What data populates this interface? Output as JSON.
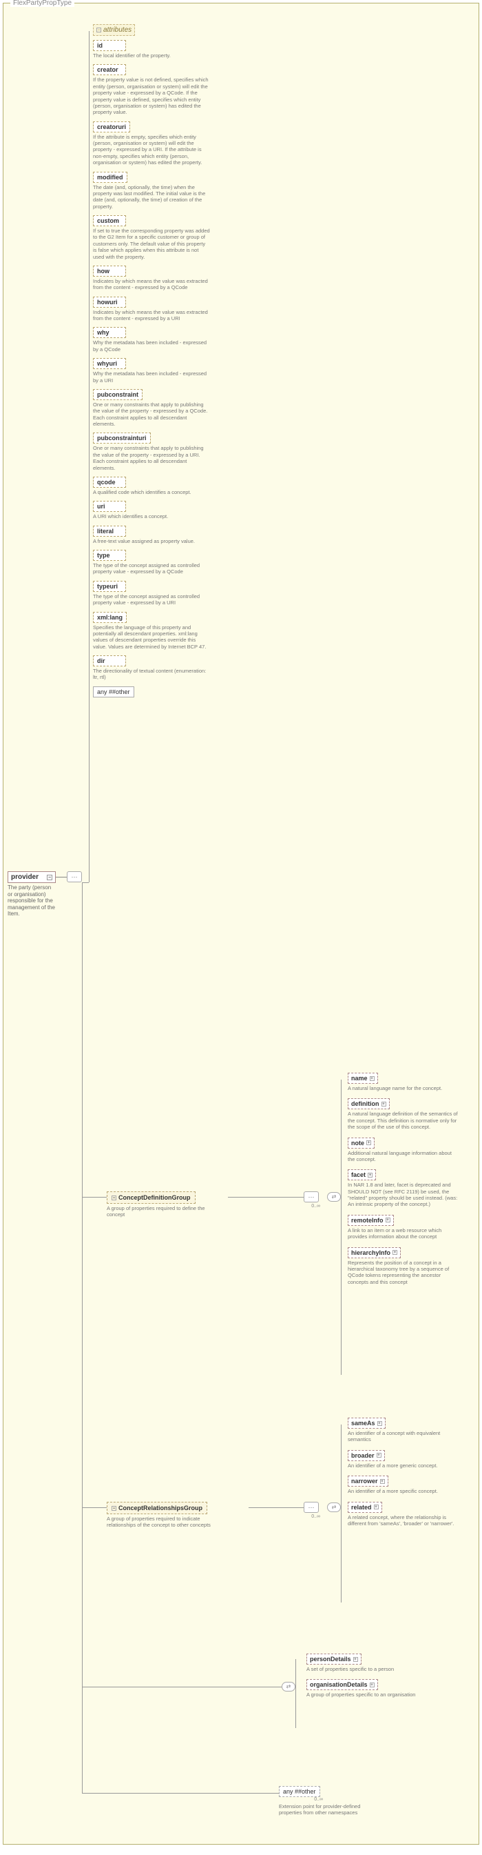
{
  "outerTitle": "FlexPartyPropType",
  "provider": {
    "label": "provider",
    "desc": "The party (person or organisation) responsible for the management of the Item."
  },
  "attributesLabel": "attributes",
  "attributes": [
    {
      "name": "id",
      "desc": "The local identifier of the property."
    },
    {
      "name": "creator",
      "desc": "If the property value is not defined, specifies which entity (person, organisation or system) will edit the property value - expressed by a QCode. If the property value is defined, specifies which entity (person, organisation or system) has edited the property value."
    },
    {
      "name": "creatoruri",
      "desc": "If the attribute is empty, specifies which entity (person, organisation or system) will edit the property - expressed by a URI. If the attribute is non-empty, specifies which entity (person, organisation or system) has edited the property."
    },
    {
      "name": "modified",
      "desc": "The date (and, optionally, the time) when the property was last modified. The initial value is the date (and, optionally, the time) of creation of the property."
    },
    {
      "name": "custom",
      "desc": "If set to true the corresponding property was added to the G2 Item for a specific customer or group of customers only. The default value of this property is false which applies when this attribute is not used with the property."
    },
    {
      "name": "how",
      "desc": "Indicates by which means the value was extracted from the content - expressed by a QCode"
    },
    {
      "name": "howuri",
      "desc": "Indicates by which means the value was extracted from the content - expressed by a URI"
    },
    {
      "name": "why",
      "desc": "Why the metadata has been included - expressed by a QCode"
    },
    {
      "name": "whyuri",
      "desc": "Why the metadata has been included - expressed by a URI"
    },
    {
      "name": "pubconstraint",
      "desc": "One or many constraints that apply to publishing the value of the property - expressed by a QCode. Each constraint applies to all descendant elements."
    },
    {
      "name": "pubconstrainturi",
      "desc": "One or many constraints that apply to publishing the value of the property - expressed by a URI. Each constraint applies to all descendant elements."
    },
    {
      "name": "qcode",
      "desc": "A qualified code which identifies a concept."
    },
    {
      "name": "uri",
      "desc": "A URI which identifies a concept."
    },
    {
      "name": "literal",
      "desc": "A free-text value assigned as property value."
    },
    {
      "name": "type",
      "desc": "The type of the concept assigned as controlled property value - expressed by a QCode"
    },
    {
      "name": "typeuri",
      "desc": "The type of the concept assigned as controlled property value - expressed by a URI"
    },
    {
      "name": "xml:lang",
      "desc": "Specifies the language of this property and potentially all descendant properties. xml:lang values of descendant properties override this value. Values are determined by Internet BCP 47."
    },
    {
      "name": "dir",
      "desc": "The directionality of textual content (enumeration: ltr, rtl)"
    }
  ],
  "anyOtherLabel": "any ##other",
  "conceptDefGroup": {
    "label": "ConceptDefinitionGroup",
    "desc": "A group of properties required to define the concept",
    "occ": "0..∞"
  },
  "conceptDefItems": [
    {
      "name": "name",
      "desc": "A natural language name for the concept."
    },
    {
      "name": "definition",
      "desc": "A natural language definition of the semantics of the concept. This definition is normative only for the scope of the use of this concept."
    },
    {
      "name": "note",
      "desc": "Additional natural language information about the concept."
    },
    {
      "name": "facet",
      "desc": "In NAR 1.8 and later, facet is deprecated and SHOULD NOT (see RFC 2119) be used, the \"related\" property should be used instead. (was: An intrinsic property of the concept.)"
    },
    {
      "name": "remoteInfo",
      "desc": "A link to an item or a web resource which provides information about the concept"
    },
    {
      "name": "hierarchyInfo",
      "desc": "Represents the position of a concept in a hierarchical taxonomy tree by a sequence of QCode tokens representing the ancestor concepts and this concept"
    }
  ],
  "conceptRelGroup": {
    "label": "ConceptRelationshipsGroup",
    "desc": "A group of properties required to indicate relationships of the concept to other concepts",
    "occ": "0..∞"
  },
  "conceptRelItems": [
    {
      "name": "sameAs",
      "desc": "An identifier of a concept with equivalent semantics"
    },
    {
      "name": "broader",
      "desc": "An identifier of a more generic concept."
    },
    {
      "name": "narrower",
      "desc": "An identifier of a more specific concept."
    },
    {
      "name": "related",
      "desc": "A related concept, where the relationship is different from 'sameAs', 'broader' or 'narrower'."
    }
  ],
  "detailChoice": [
    {
      "name": "personDetails",
      "desc": "A set of properties specific to a person"
    },
    {
      "name": "organisationDetails",
      "desc": "A group of properties specific to an organisation"
    }
  ],
  "bottomAny": {
    "label": "any ##other",
    "desc": "Extension point for provider-defined properties from other namespaces",
    "occ": "0..∞"
  }
}
